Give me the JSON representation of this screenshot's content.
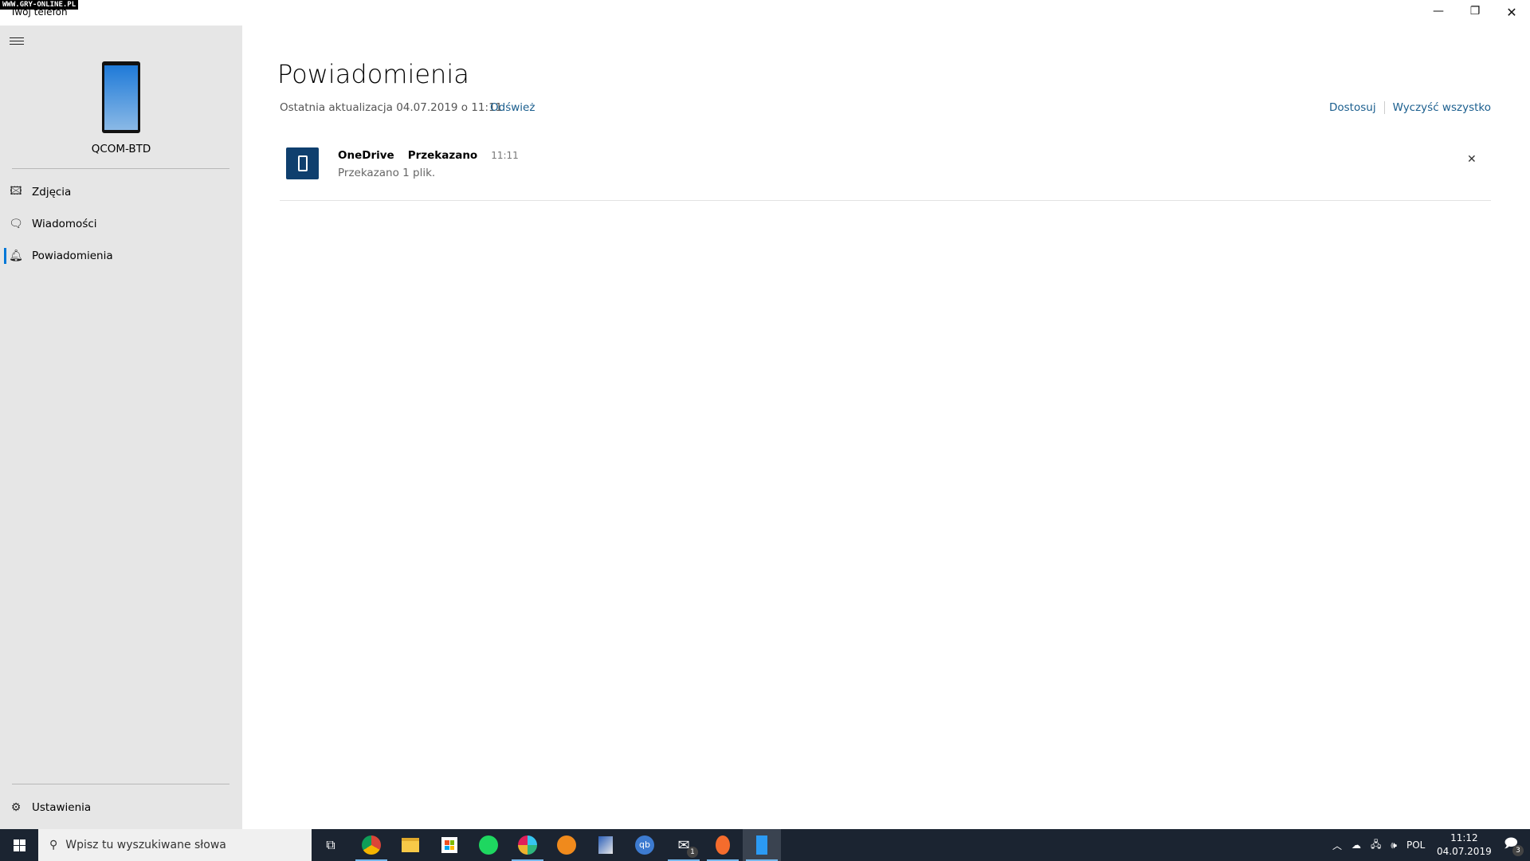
{
  "watermark": "WWW.GRY-ONLINE.PL",
  "window": {
    "title": "Twój telefon",
    "minimize_icon": "minimize-icon",
    "maximize_icon": "restore-icon",
    "close_icon": "close-icon"
  },
  "sidebar": {
    "device_name": "QCOM-BTD",
    "items": [
      {
        "label": "Zdjęcia",
        "icon": "photos-icon"
      },
      {
        "label": "Wiadomości",
        "icon": "message-icon"
      },
      {
        "label": "Powiadomienia",
        "icon": "bell-icon",
        "active": true
      }
    ],
    "settings_label": "Ustawienia"
  },
  "main": {
    "title": "Powiadomienia",
    "last_update": "Ostatnia aktualizacja 04.07.2019 o 11:11",
    "refresh": "Odśwież",
    "customize": "Dostosuj",
    "clear_all": "Wyczyść wszystko",
    "notifications": [
      {
        "app": "OneDrive",
        "title": "Przekazano",
        "time": "11:11",
        "body": "Przekazano 1 plik."
      }
    ]
  },
  "taskbar": {
    "search_placeholder": "Wpisz tu wyszukiwane słowa",
    "apps": [
      "task-view",
      "chrome",
      "file-explorer",
      "store",
      "spotify",
      "slack",
      "xnview",
      "image-editor",
      "qbittorrent",
      "mail",
      "origin",
      "your-phone"
    ],
    "mail_badge": "1",
    "language": "POL",
    "time": "11:12",
    "date": "04.07.2019",
    "action_center_badge": "3"
  },
  "colors": {
    "accent": "#0078d7",
    "link": "#1a5e8e",
    "notification_icon_bg": "#0f3f6e",
    "sidebar_bg": "#e6e6e6",
    "taskbar_bg": "#1b2431"
  }
}
